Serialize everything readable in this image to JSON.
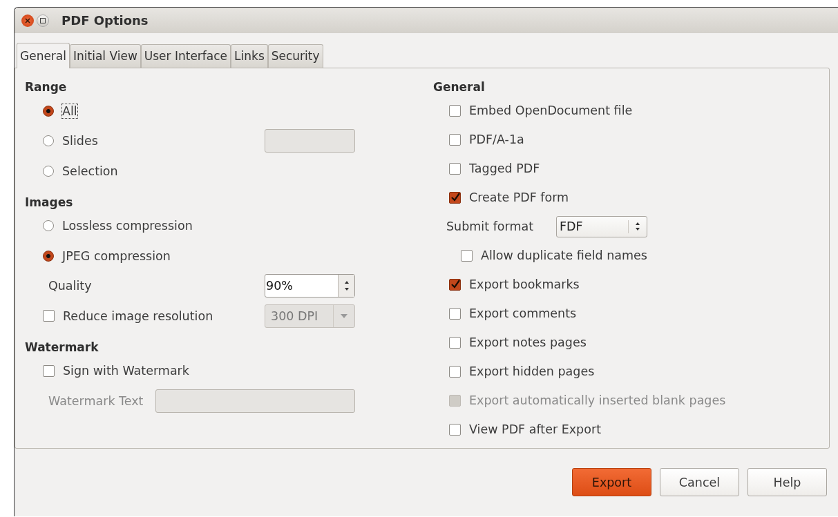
{
  "window": {
    "title": "PDF Options"
  },
  "tabs": [
    {
      "label": "General",
      "selected": true
    },
    {
      "label": "Initial View",
      "selected": false
    },
    {
      "label": "User Interface",
      "selected": false
    },
    {
      "label": "Links",
      "selected": false
    },
    {
      "label": "Security",
      "selected": false
    }
  ],
  "left": [
    {
      "title": "Range",
      "items": [
        {
          "kind": "radio",
          "label": "All",
          "selected": true,
          "focused": true
        },
        {
          "kind": "radio",
          "label": "Slides",
          "selected": false,
          "field": {
            "disabled": true
          }
        },
        {
          "kind": "radio",
          "label": "Selection",
          "selected": false
        }
      ]
    },
    {
      "title": "Images",
      "items": [
        {
          "kind": "radio",
          "label": "Lossless compression",
          "selected": false
        },
        {
          "kind": "radio",
          "label": "JPEG compression",
          "selected": true
        },
        {
          "kind": "spin",
          "label": "Quality",
          "value": "90%"
        },
        {
          "kind": "checkbox",
          "label": "Reduce image resolution",
          "checked": false,
          "combo": {
            "value": "300 DPI",
            "disabled": true
          }
        }
      ]
    },
    {
      "title": "Watermark",
      "items": [
        {
          "kind": "checkbox",
          "label": "Sign with Watermark",
          "checked": false
        },
        {
          "kind": "textfield",
          "label": "Watermark Text",
          "disabled": true
        }
      ]
    }
  ],
  "right": {
    "title": "General",
    "items": [
      {
        "kind": "checkbox",
        "label": "Embed OpenDocument file",
        "checked": false,
        "disabled": false
      },
      {
        "kind": "checkbox",
        "label": "PDF/A-1a",
        "checked": false,
        "disabled": false
      },
      {
        "kind": "checkbox",
        "label": "Tagged PDF",
        "checked": false,
        "disabled": false
      },
      {
        "kind": "checkbox",
        "label": "Create PDF form",
        "checked": true,
        "disabled": false,
        "children": [
          {
            "kind": "select",
            "label": "Submit format",
            "value": "FDF"
          },
          {
            "kind": "checkbox",
            "label": "Allow duplicate field names",
            "checked": false,
            "disabled": false
          }
        ]
      },
      {
        "kind": "checkbox",
        "label": "Export bookmarks",
        "checked": true,
        "disabled": false
      },
      {
        "kind": "checkbox",
        "label": "Export comments",
        "checked": false,
        "disabled": false
      },
      {
        "kind": "checkbox",
        "label": "Export notes pages",
        "checked": false,
        "disabled": false
      },
      {
        "kind": "checkbox",
        "label": "Export hidden pages",
        "checked": false,
        "disabled": false
      },
      {
        "kind": "checkbox",
        "label": "Export automatically inserted blank pages",
        "checked": false,
        "disabled": true
      },
      {
        "kind": "checkbox",
        "label": "View PDF after Export",
        "checked": false,
        "disabled": false
      }
    ]
  },
  "buttons": [
    {
      "label": "Export",
      "default": true
    },
    {
      "label": "Cancel",
      "default": false
    },
    {
      "label": "Help",
      "default": false
    }
  ]
}
